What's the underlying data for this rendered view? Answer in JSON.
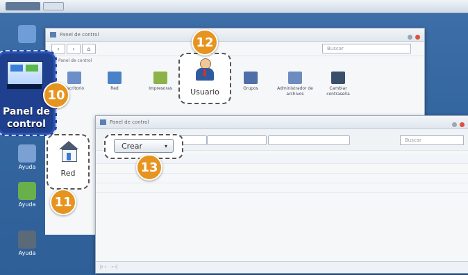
{
  "topbar": {
    "tabs": [
      "",
      ""
    ]
  },
  "desktop_icons": [
    {
      "label": "",
      "color": "#6f9dd6"
    },
    {
      "label": "Ayuda",
      "color": "#7aa1d2"
    },
    {
      "label": "Ayuda",
      "color": "#69b04c"
    },
    {
      "label": "Ayuda",
      "color": "#5b6a78"
    }
  ],
  "panel_control": {
    "label_line1": "Panel de",
    "label_line2": "control"
  },
  "badges": {
    "b10": "10",
    "b11": "11",
    "b12": "12",
    "b13": "13"
  },
  "win1": {
    "title": "Panel de control",
    "search_placeholder": "Buscar",
    "breadcrumb": "Panel de control",
    "icons": [
      {
        "label": "Escritorio",
        "color": "#6b8fc6"
      },
      {
        "label": "Red",
        "color": "#4a82c8"
      },
      {
        "label": "Impresoras",
        "color": "#8bb34a"
      },
      {
        "label": "Grupos",
        "color": "#4f6fa8"
      },
      {
        "label": "Administrador de archivos",
        "color": "#6c8cc0"
      },
      {
        "label": "Cambiar contraseña",
        "color": "#3a4f6a"
      }
    ]
  },
  "usuario": {
    "label": "Usuario"
  },
  "win2": {
    "title": "Panel de control",
    "toolbar": [
      "",
      "",
      ""
    ],
    "search_placeholder": "Buscar",
    "crear_label": "Crear",
    "columns": [
      "",
      "",
      "",
      ""
    ],
    "rows": [
      {
        "c1": "",
        "c2": "",
        "c3": "",
        "c4": ""
      },
      {
        "c1": "",
        "c2": "",
        "c3": "",
        "c4": ""
      },
      {
        "c1": "",
        "c2": "",
        "c3": "",
        "c4": ""
      }
    ],
    "status": ""
  },
  "red": {
    "label": "Red"
  },
  "colors": {
    "accent": "#e6941f",
    "desktop": "#3466a0",
    "tile": "#1f3f8f"
  }
}
